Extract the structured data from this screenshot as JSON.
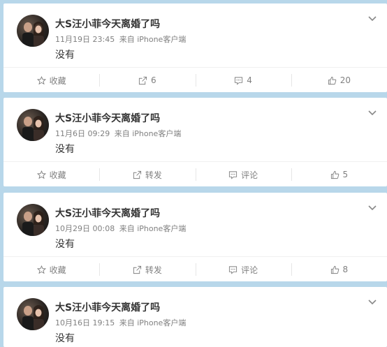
{
  "posts": [
    {
      "name": "大S汪小菲今天离婚了吗",
      "time": "11月19日 23:45",
      "source": "来自 iPhone客户端",
      "content": "没有",
      "actions": {
        "favorite": "收藏",
        "repost": "6",
        "comment": "4",
        "like": "20"
      }
    },
    {
      "name": "大S汪小菲今天离婚了吗",
      "time": "11月6日 09:29",
      "source": "来自 iPhone客户端",
      "content": "没有",
      "actions": {
        "favorite": "收藏",
        "repost": "转发",
        "comment": "评论",
        "like": "5"
      }
    },
    {
      "name": "大S汪小菲今天离婚了吗",
      "time": "10月29日 00:08",
      "source": "来自 iPhone客户端",
      "content": "没有",
      "actions": {
        "favorite": "收藏",
        "repost": "转发",
        "comment": "评论",
        "like": "8"
      }
    },
    {
      "name": "大S汪小菲今天离婚了吗",
      "time": "10月16日 19:15",
      "source": "来自 iPhone客户端",
      "content": "没有"
    }
  ]
}
